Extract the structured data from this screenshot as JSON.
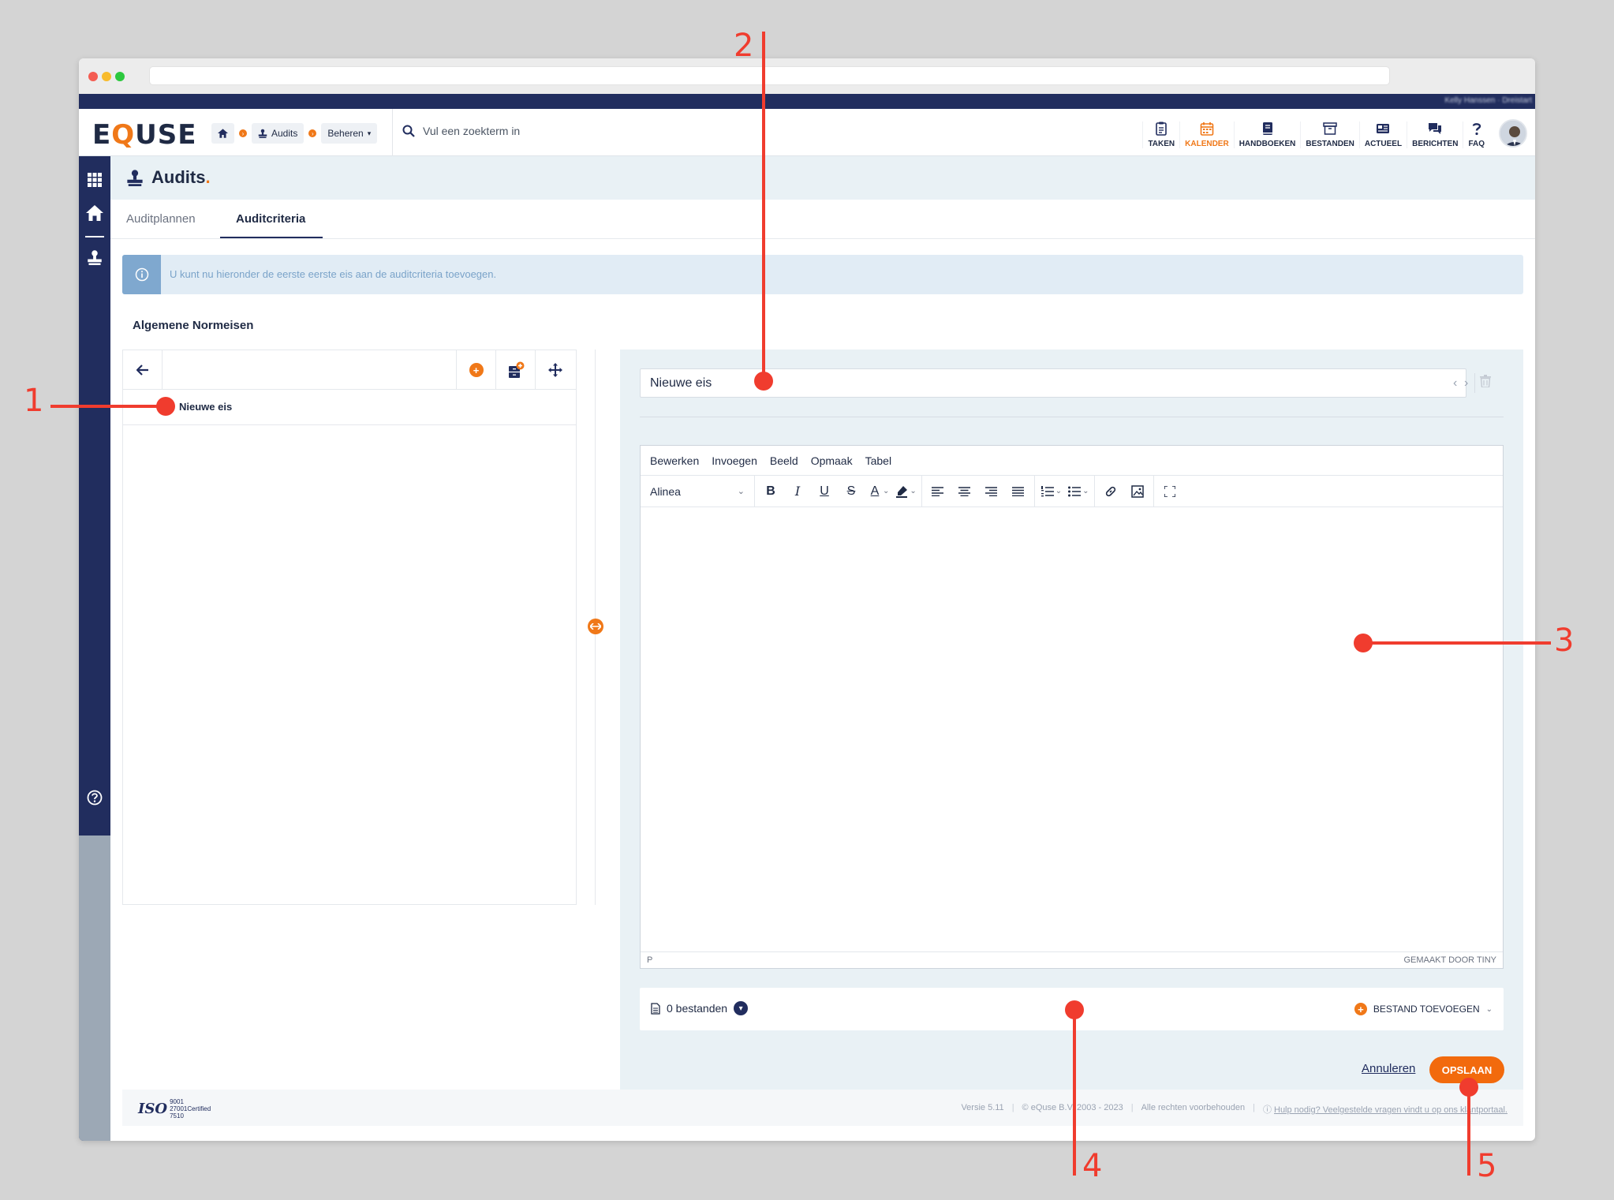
{
  "topbar": {
    "user_text": "Kelly Hanssen · Dreistart"
  },
  "header": {
    "logo_pre": "E",
    "logo_q": "Q",
    "logo_post": "USE",
    "breadcrumbs": {
      "audits": "Audits",
      "beheren": "Beheren"
    },
    "search_placeholder": "Vul een zoekterm in",
    "nav": [
      {
        "label": "TAKEN",
        "icon": "clipboard-icon"
      },
      {
        "label": "KALENDER",
        "icon": "calendar-icon",
        "active": true
      },
      {
        "label": "HANDBOEKEN",
        "icon": "book-icon"
      },
      {
        "label": "BESTANDEN",
        "icon": "archive-icon"
      },
      {
        "label": "ACTUEEL",
        "icon": "newspaper-icon"
      },
      {
        "label": "BERICHTEN",
        "icon": "chat-icon"
      },
      {
        "label": "FAQ",
        "icon": "question-icon"
      }
    ]
  },
  "page": {
    "title": "Audits",
    "title_dot": "."
  },
  "tabs": [
    {
      "label": "Auditplannen",
      "active": false
    },
    {
      "label": "Auditcriteria",
      "active": true
    }
  ],
  "info": {
    "text": "U kunt nu hieronder de eerste eerste eis aan de auditcriteria toevoegen."
  },
  "section": {
    "title": "Algemene Normeisen"
  },
  "tree": {
    "items": [
      {
        "label": "Nieuwe eis"
      }
    ]
  },
  "requirement": {
    "title_value": "Nieuwe eis"
  },
  "editor": {
    "menu": [
      "Bewerken",
      "Invoegen",
      "Beeld",
      "Opmaak",
      "Tabel"
    ],
    "format": "Alinea",
    "status_left": "P",
    "status_right": "GEMAAKT DOOR TINY"
  },
  "files": {
    "count_label": "0 bestanden",
    "add_label": "BESTAND TOEVOEGEN"
  },
  "actions": {
    "cancel": "Annuleren",
    "save": "OPSLAAN"
  },
  "footer": {
    "iso_big": "ISO",
    "iso_codes": [
      "9001",
      "27001",
      "7510"
    ],
    "iso_certified": "Certified",
    "version": "Versie 5.11",
    "copyright": "© eQuse B.V. 2003 - 2023",
    "rights": "Alle rechten voorbehouden",
    "help": "Hulp nodig? Veelgestelde vragen vindt u op ons klantportaal."
  },
  "annotations": [
    "1",
    "2",
    "3",
    "4",
    "5"
  ],
  "colors": {
    "navy": "#212d5e",
    "orange": "#f07818",
    "annotation": "#f03c2e"
  }
}
